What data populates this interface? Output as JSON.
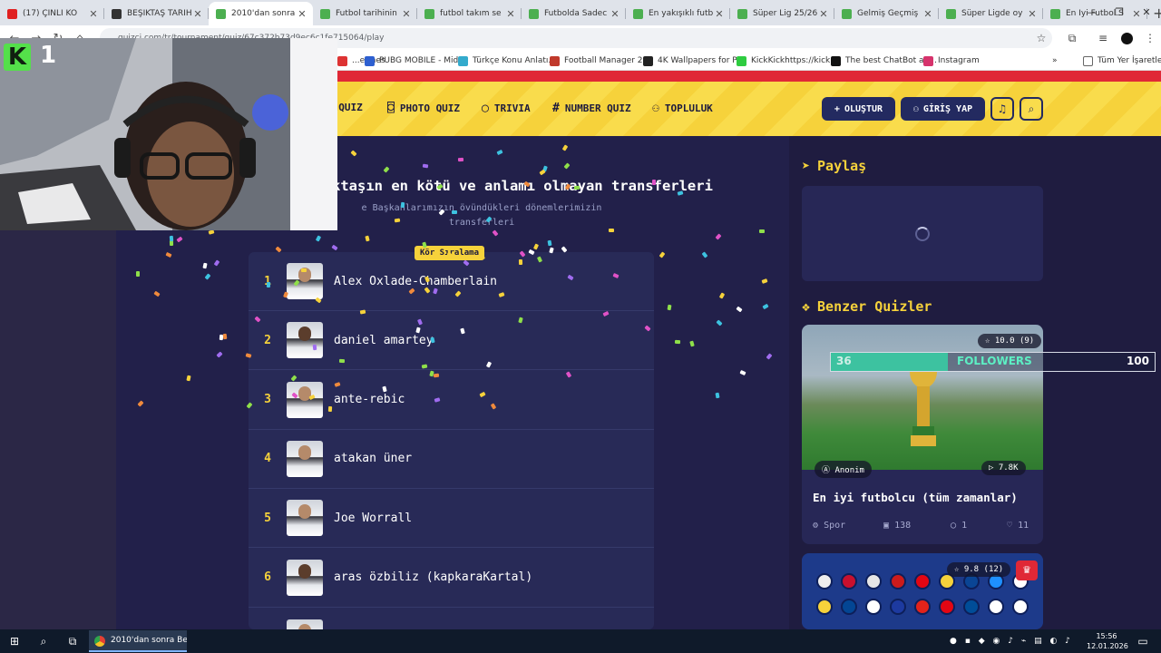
{
  "browser": {
    "tabs": [
      {
        "title": "(17) ÇİNLİ KO",
        "favicon_color": "#e02020",
        "active": false
      },
      {
        "title": "BEŞİKTAŞ TARİHİ",
        "favicon_color": "#333333",
        "active": false
      },
      {
        "title": "2010'dan sonra",
        "favicon_color": "#4caf50",
        "active": true
      },
      {
        "title": "Futbol tarihinin",
        "favicon_color": "#4caf50",
        "active": false
      },
      {
        "title": "futbol takım se",
        "favicon_color": "#4caf50",
        "active": false
      },
      {
        "title": "Futbolda Sadec",
        "favicon_color": "#4caf50",
        "active": false
      },
      {
        "title": "En yakışıklı futb",
        "favicon_color": "#4caf50",
        "active": false
      },
      {
        "title": "Süper Lig 25/26",
        "favicon_color": "#4caf50",
        "active": false
      },
      {
        "title": "Gelmiş Geçmiş",
        "favicon_color": "#4caf50",
        "active": false
      },
      {
        "title": "Süper Ligde oy",
        "favicon_color": "#4caf50",
        "active": false
      },
      {
        "title": "En İyi Futbol S",
        "favicon_color": "#4caf50",
        "active": false
      }
    ],
    "new_tab": "+",
    "url": "quizci.com/tr/tournament/quiz/67c372b73d9ec6c1fe715064/play",
    "bookmarks": [
      {
        "label": "...ermes",
        "color": "#d33"
      },
      {
        "label": "PUBG MOBILE - Mid...",
        "color": "#2d5fd0"
      },
      {
        "label": "Türkçe Konu Anlatı...",
        "color": "#33aacc"
      },
      {
        "label": "Football Manager 2...",
        "color": "#c0392b"
      },
      {
        "label": "4K Wallpapers for P...",
        "color": "#222222"
      },
      {
        "label": "KickKickhttps://kick...",
        "color": "#2ecc40"
      },
      {
        "label": "The best ChatBot an...",
        "color": "#111111"
      },
      {
        "label": "Instagram",
        "color": "#d6336c"
      }
    ],
    "all_bookmarks": "Tüm Yer İşaretleri"
  },
  "site": {
    "nav": [
      {
        "label": "C QUIZ",
        "icon": "list-icon"
      },
      {
        "label": "PHOTO QUIZ",
        "icon": "camera-icon"
      },
      {
        "label": "TRIVIA",
        "icon": "chat-icon"
      },
      {
        "label": "NUMBER QUIZ",
        "icon": "hash-icon"
      },
      {
        "label": "TOPLULUK",
        "icon": "users-icon"
      }
    ],
    "create_label": "OLUŞTUR",
    "login_label": "GİRİŞ YAP",
    "quiz": {
      "title": "ktaşın en kötü ve anlamı olmayan transferleri",
      "subtitle": "e Başkanlarımızın övündükleri dönemlerimizin transferleri",
      "badge": "Kör Sıralama",
      "players": [
        {
          "rank": "1",
          "name": "Alex Oxlade-Chamberlain"
        },
        {
          "rank": "2",
          "name": "daniel amartey"
        },
        {
          "rank": "3",
          "name": "ante-rebic"
        },
        {
          "rank": "4",
          "name": "atakan üner"
        },
        {
          "rank": "5",
          "name": "Joe Worrall"
        },
        {
          "rank": "6",
          "name": "aras özbiliz (kapkaraKartal)"
        }
      ]
    },
    "share_title": "Paylaş",
    "similar_title": "Benzer Quizler",
    "cards": [
      {
        "rating": "10.0",
        "rating_count": "(9)",
        "author": "Anonim",
        "plays": "7.8K",
        "title": "En iyi futbolcu (tüm zamanlar)",
        "category": "Spor",
        "items": "138",
        "comments": "1",
        "likes": "11"
      },
      {
        "rating": "9.8",
        "rating_count": "(12)"
      }
    ]
  },
  "overlay": {
    "followers_count": "36",
    "followers_label": "FOLLOWERS",
    "followers_goal": "100",
    "followers_progress": 0.36,
    "cam_logo": "1"
  },
  "taskbar": {
    "app_title": "2010'dan sonra Beşi...",
    "time": "15:56",
    "date": "12.01.2026"
  },
  "colors": {
    "accent_yellow": "#f6d23b",
    "bg_dark": "#1f1c40",
    "followers_bar": "#3dc2a0"
  }
}
